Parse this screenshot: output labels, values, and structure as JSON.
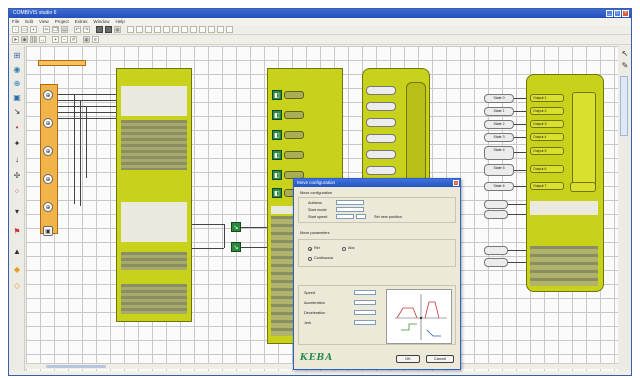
{
  "window": {
    "title": "COMBIVIS studio 6"
  },
  "menubar": {
    "items": [
      "File",
      "Edit",
      "View",
      "Project",
      "Extras",
      "Window",
      "Help"
    ]
  },
  "toolbar": {
    "row1_icons": [
      "new-icon",
      "open-icon",
      "save-icon",
      "cut-icon",
      "copy-icon",
      "paste-icon",
      "undo-icon",
      "redo-icon",
      "grid-icon",
      "zoom-icon",
      "print-icon"
    ],
    "row2_icons": [
      "arrow-icon",
      "select-icon",
      "link-icon",
      "connect-icon",
      "zoom-in-icon",
      "zoom-out-icon",
      "grid-icon",
      "table-icon"
    ]
  },
  "left_tools": [
    "pointer-icon",
    "block-icon",
    "move-icon",
    "text-icon",
    "connector-icon",
    "dot-icon",
    "pin-icon",
    "arrow-icon",
    "marker-icon",
    "io-icon",
    "warning-icon",
    "diamond-icon"
  ],
  "diagram": {
    "note": "",
    "pill_labels": [
      "",
      "",
      "",
      "",
      "",
      "",
      "",
      ""
    ],
    "state_labels": [
      "State 0",
      "State 1",
      "State 2",
      "State 3",
      "State 4",
      "State 5",
      "State 6"
    ],
    "mid_labels": [
      "Output 1",
      "Output 2",
      "Output 3",
      "Output 4",
      "Output 5",
      "Output 6",
      "Output 7",
      "Output 8"
    ]
  },
  "dialog": {
    "title": "Move configuration",
    "section1": "Move configuration",
    "label_a": "Address",
    "label_b": "Start mode",
    "label_c": "Start speed",
    "value_a": "",
    "value_b": "",
    "value_c": "",
    "check_label": "Set new position",
    "section2": "Move parameters",
    "radio_a": "Rel",
    "radio_b": "Abs",
    "radio_c": "Continuous",
    "param_labels": [
      "Speed",
      "Acceleration",
      "Deceleration",
      "Jerk"
    ],
    "param_values": [
      "",
      "",
      "",
      ""
    ],
    "logo": "KEBA",
    "ok_label": "OK",
    "cancel_label": "Cancel"
  }
}
